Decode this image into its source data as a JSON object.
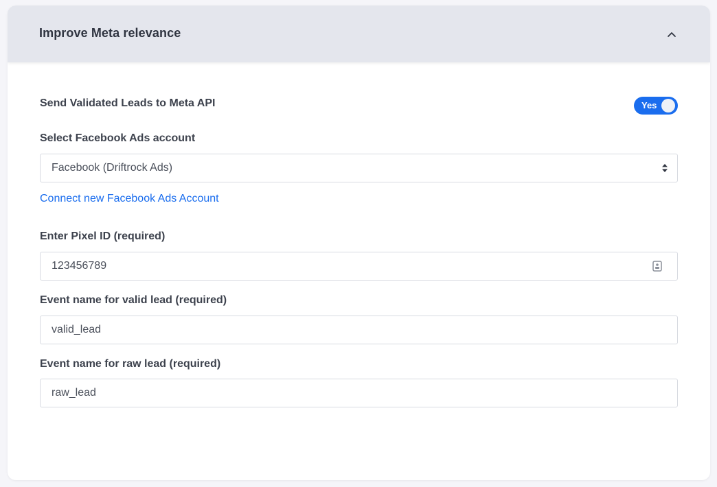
{
  "section": {
    "title": "Improve Meta relevance"
  },
  "send_leads": {
    "label": "Send Validated Leads to Meta API",
    "toggle_text": "Yes"
  },
  "ads_account": {
    "label": "Select Facebook Ads account",
    "selected": "Facebook (Driftrock Ads)",
    "connect_link": "Connect new Facebook Ads Account"
  },
  "pixel": {
    "label": "Enter Pixel ID (required)",
    "value": "123456789"
  },
  "valid_event": {
    "label": "Event name for valid lead (required)",
    "value": "valid_lead"
  },
  "raw_event": {
    "label": "Event name for raw lead (required)",
    "value": "raw_lead"
  },
  "colors": {
    "accent": "#1a6dee",
    "header_bg": "#e4e6ed"
  },
  "icons": {
    "collapse": "chevron-up-icon",
    "select": "select-arrows-icon",
    "pixel_field": "contact-card-icon"
  }
}
